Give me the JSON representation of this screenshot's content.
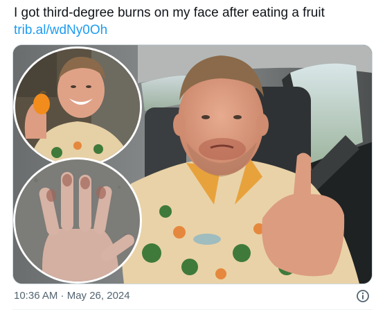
{
  "tweet": {
    "text": "I got third-degree burns on my face after eating a fruit",
    "link": "trib.al/wdNy0Oh"
  },
  "media": {
    "main_photo": "man in car giving thumbs up",
    "inset_top_photo": "man smiling holding orange fruit",
    "inset_bottom_photo": "hand with burned fingers"
  },
  "meta": {
    "timestamp": "10:36 AM · May 26, 2024"
  },
  "icons": {
    "info": "info-icon"
  },
  "colors": {
    "link": "#1d9bf0",
    "text": "#0f1419",
    "muted": "#536471"
  }
}
